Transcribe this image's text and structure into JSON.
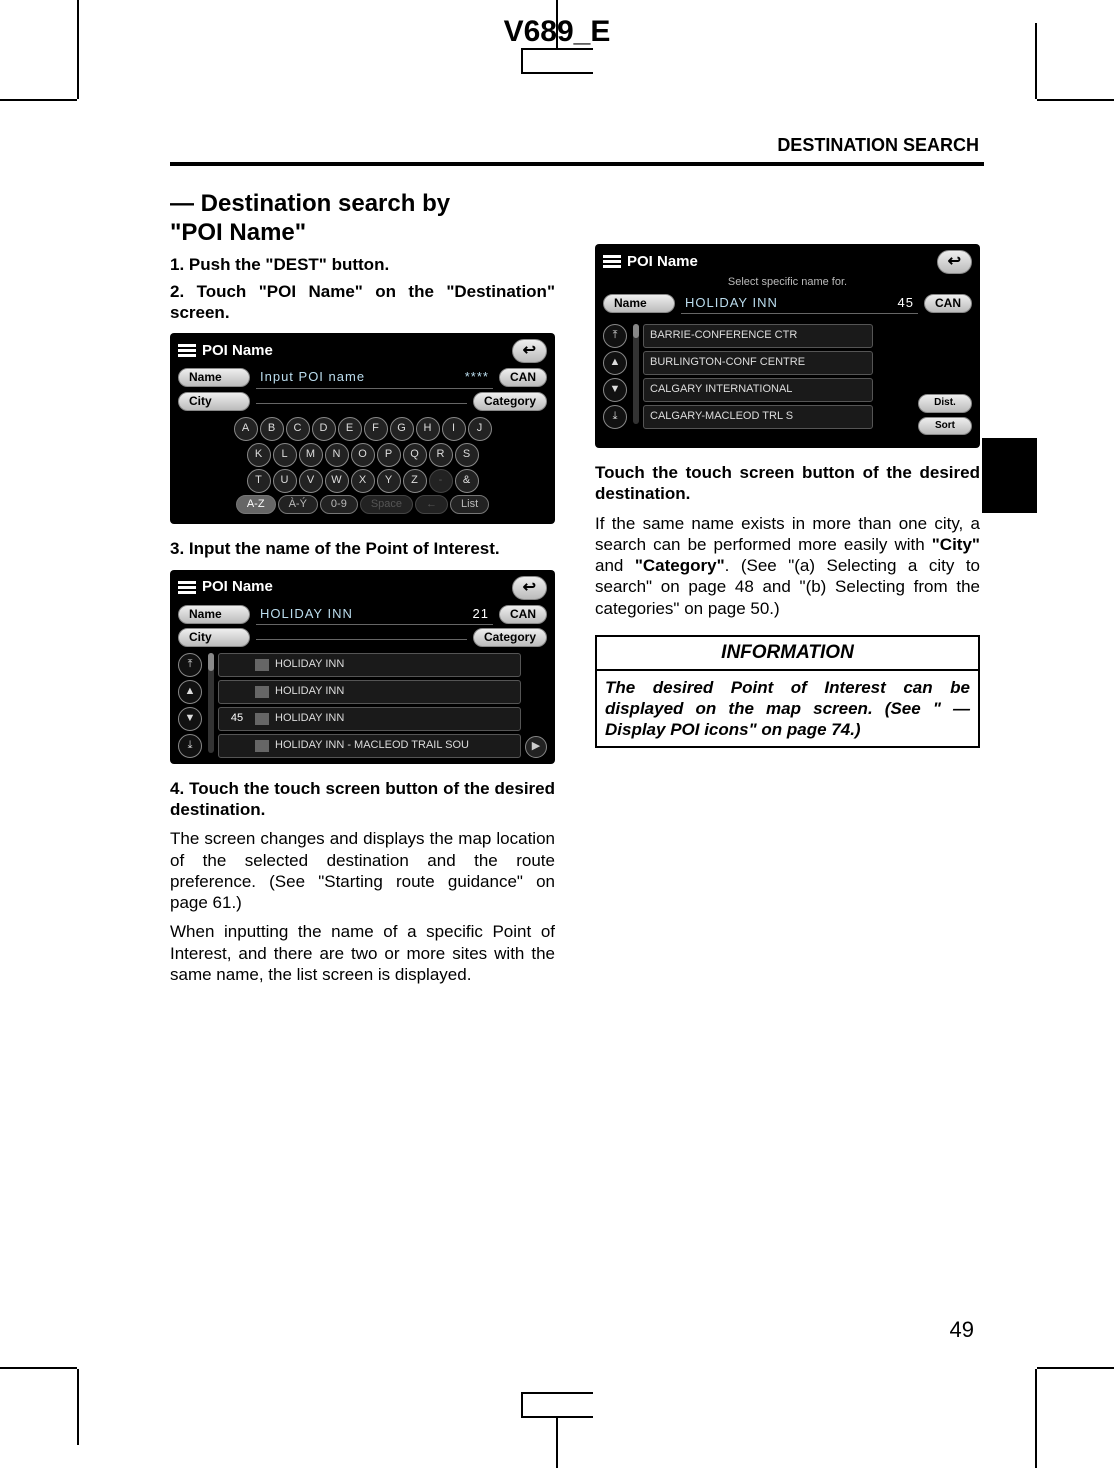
{
  "doc_code": "V689_E",
  "running_head": "DESTINATION SEARCH",
  "page_number": "49",
  "section_title_line1": "— Destination search by",
  "section_title_line2": "\"POI Name\"",
  "steps": {
    "s1": "1.   Push the \"DEST\" button.",
    "s2": "2.  Touch \"POI Name\" on the \"Destination\" screen.",
    "s3": "3.  Input  the  name  of  the  Point  of Interest.",
    "s4": "4.   Touch the touch screen button of the desired destination."
  },
  "body": {
    "p1": "The  screen  changes  and  displays  the map  location  of  the  selected  destination and  the  route  preference.    (See  \"Starting route guidance\" on page 61.)",
    "p2": "When  inputting  the  name  of  a  specific Point  of  Interest,  and  there  are  two  or more  sites  with  the  same  name,  the  list screen is displayed.",
    "r1": "Touch the touch screen button of the desired destination.",
    "r2_a": "If  the  same  name  exists  in  more  than one  city,  a  search  can  be  performed more easily with ",
    "r2_b": "\"City\"",
    "r2_c": " and ",
    "r2_d": "\"Category\"",
    "r2_e": ". (See  \"(a)  Selecting  a  city  to  search\"  on page  48  and  \"(b)  Selecting  from  the categories\" on page 50.)"
  },
  "info": {
    "title": "INFORMATION",
    "body": "The desired Point of Interest can be displayed on the map screen.   (See \" — Display POI icons\" on page 74.)"
  },
  "shot1": {
    "title": "POI Name",
    "name_label": "Name",
    "name_placeholder": "Input POI name",
    "name_mask": "****",
    "can_label": "CAN",
    "city_label": "City",
    "category_label": "Category",
    "row1": [
      "A",
      "B",
      "C",
      "D",
      "E",
      "F",
      "G",
      "H",
      "I",
      "J"
    ],
    "row2": [
      "K",
      "L",
      "M",
      "N",
      "O",
      "P",
      "Q",
      "R",
      "S"
    ],
    "row3": [
      "T",
      "U",
      "V",
      "W",
      "X",
      "Y",
      "Z",
      "-",
      "&"
    ],
    "bottom": {
      "az": "A-Z",
      "ay": "À-Ý",
      "num": "0-9",
      "space": "Space",
      "back": "←",
      "list": "List"
    }
  },
  "shot2": {
    "title": "POI Name",
    "name_label": "Name",
    "name_value": "HOLIDAY INN",
    "name_count": "21",
    "can_label": "CAN",
    "city_label": "City",
    "category_label": "Category",
    "rows": [
      {
        "num": "",
        "text": "HOLIDAY INN"
      },
      {
        "num": "",
        "text": "HOLIDAY INN"
      },
      {
        "num": "45",
        "text": "HOLIDAY INN"
      },
      {
        "num": "",
        "text": "HOLIDAY INN - MACLEOD TRAIL SOU"
      }
    ]
  },
  "shot3": {
    "title": "POI Name",
    "subtitle": "Select specific name for.",
    "name_label": "Name",
    "name_value": "HOLIDAY INN",
    "name_count": "45",
    "can_label": "CAN",
    "rows": [
      "BARRIE-CONFERENCE CTR",
      "BURLINGTON-CONF CENTRE",
      "CALGARY INTERNATIONAL",
      "CALGARY-MACLEOD TRL S"
    ],
    "side": {
      "dist": "Dist.",
      "sort": "Sort"
    }
  }
}
